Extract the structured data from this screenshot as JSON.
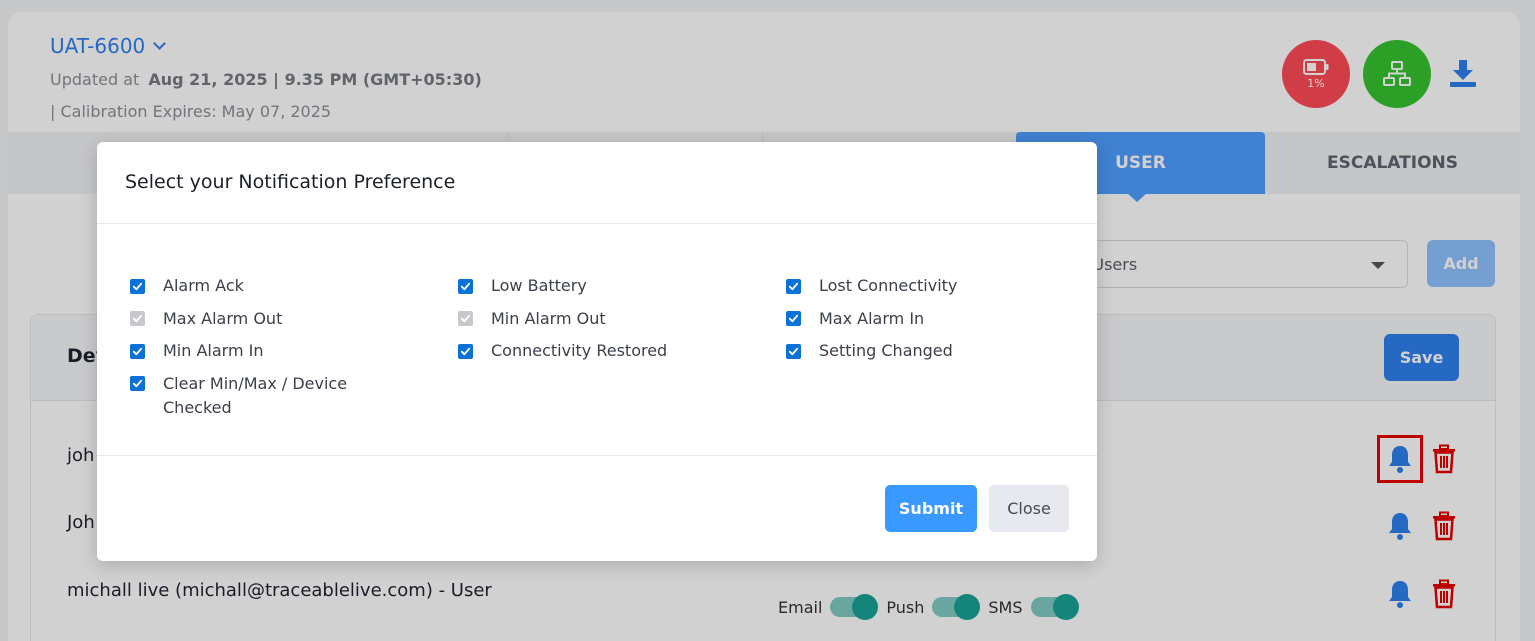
{
  "device": {
    "name": "UAT-6600",
    "updated_prefix": "Updated at",
    "updated_value": "Aug 21, 2025 | 9.35 PM (GMT+05:30)",
    "calibration": "|  Calibration Expires: May 07, 2025",
    "battery_pct": "1%"
  },
  "tabs": {
    "user": "USER",
    "escalations": "ESCALATIONS"
  },
  "users_form": {
    "select_text": "t Users",
    "add_label": "Add"
  },
  "panel": {
    "title_partial": "Dev",
    "save_label": "Save",
    "rows": [
      {
        "text": "joh"
      },
      {
        "text": "Joh"
      },
      {
        "text": "michall live (michall@traceablelive.com) - User"
      }
    ],
    "toggles": {
      "email": "Email",
      "push": "Push",
      "sms": "SMS"
    }
  },
  "modal": {
    "title": "Select your Notification Preference",
    "columns": [
      [
        {
          "label": "Alarm Ack",
          "checked": true,
          "disabled": false
        },
        {
          "label": "Max Alarm Out",
          "checked": true,
          "disabled": true
        },
        {
          "label": "Min Alarm In",
          "checked": true,
          "disabled": false
        },
        {
          "label": "Clear Min/Max / Device Checked",
          "checked": true,
          "disabled": false
        }
      ],
      [
        {
          "label": "Low Battery",
          "checked": true,
          "disabled": false
        },
        {
          "label": "Min Alarm Out",
          "checked": true,
          "disabled": true
        },
        {
          "label": "Connectivity Restored",
          "checked": true,
          "disabled": false
        }
      ],
      [
        {
          "label": "Lost Connectivity",
          "checked": true,
          "disabled": false
        },
        {
          "label": "Max Alarm In",
          "checked": true,
          "disabled": false
        },
        {
          "label": "Setting Changed",
          "checked": true,
          "disabled": false
        }
      ]
    ],
    "submit_label": "Submit",
    "close_label": "Close"
  },
  "colors": {
    "accent": "#2f80ed",
    "checkbox": "#0a72d6",
    "danger": "#e60000",
    "battery": "#ff4b57",
    "network": "#36c32f",
    "toggle": "#1aa396"
  }
}
